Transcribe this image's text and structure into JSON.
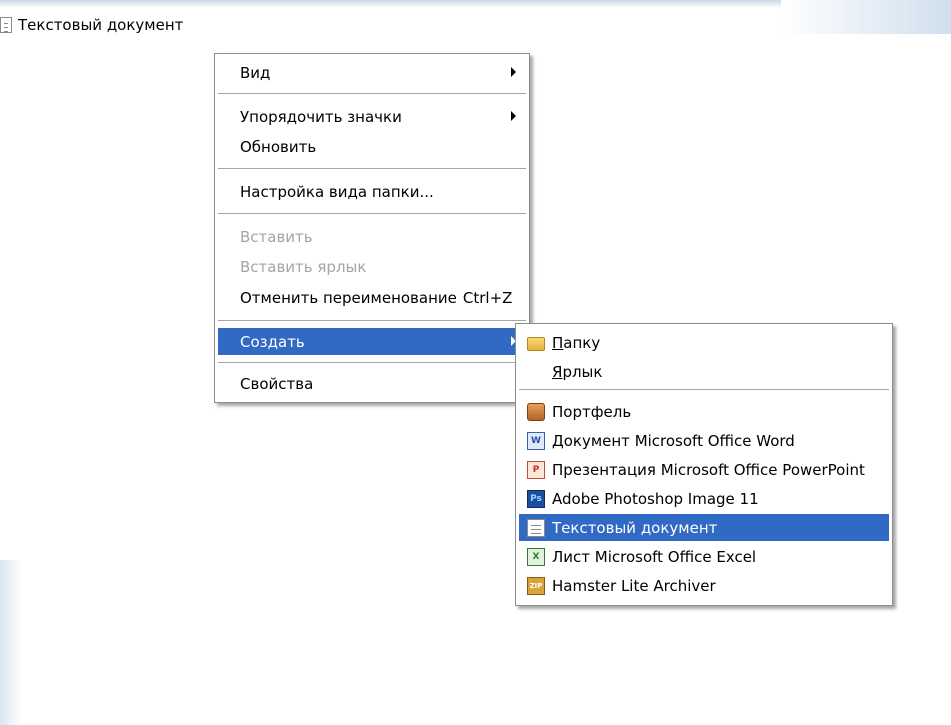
{
  "desktop": {
    "file_label": "Текстовый документ",
    "file_icon": "text-file-icon"
  },
  "context_menu": {
    "items": [
      {
        "label": "Вид",
        "has_submenu": true,
        "enabled": true
      },
      {
        "label": "Упорядочить значки",
        "has_submenu": true,
        "enabled": true
      },
      {
        "label": "Обновить",
        "enabled": true
      },
      {
        "label": "Настройка вида папки...",
        "enabled": true
      },
      {
        "label": "Вставить",
        "enabled": false
      },
      {
        "label": "Вставить ярлык",
        "enabled": false
      },
      {
        "label": "Отменить переименование",
        "shortcut": "Ctrl+Z",
        "enabled": true
      },
      {
        "label": "Создать",
        "has_submenu": true,
        "enabled": true,
        "selected": true
      },
      {
        "label": "Свойства",
        "enabled": true
      }
    ]
  },
  "submenu_create": {
    "items": [
      {
        "label": "Папку",
        "icon": "folder-icon",
        "mnemonic": "П",
        "rest": "апку"
      },
      {
        "label": "Ярлык",
        "icon": "none",
        "mnemonic": "Я",
        "rest": "рлык"
      },
      {
        "label": "Портфель",
        "icon": "briefcase-icon"
      },
      {
        "label": "Документ Microsoft Office Word",
        "icon": "word-document-icon"
      },
      {
        "label": "Презентация Microsoft Office PowerPoint",
        "icon": "powerpoint-icon"
      },
      {
        "label": "Adobe Photoshop Image 11",
        "icon": "photoshop-icon"
      },
      {
        "label": "Текстовый документ",
        "icon": "text-document-icon",
        "selected": true
      },
      {
        "label": "Лист Microsoft Office Excel",
        "icon": "excel-icon"
      },
      {
        "label": "Hamster Lite Archiver",
        "icon": "zip-archive-icon"
      }
    ]
  },
  "colors": {
    "selection": "#316ac5",
    "disabled_text": "#a4a4a4",
    "menu_border": "#8d8d8d"
  }
}
